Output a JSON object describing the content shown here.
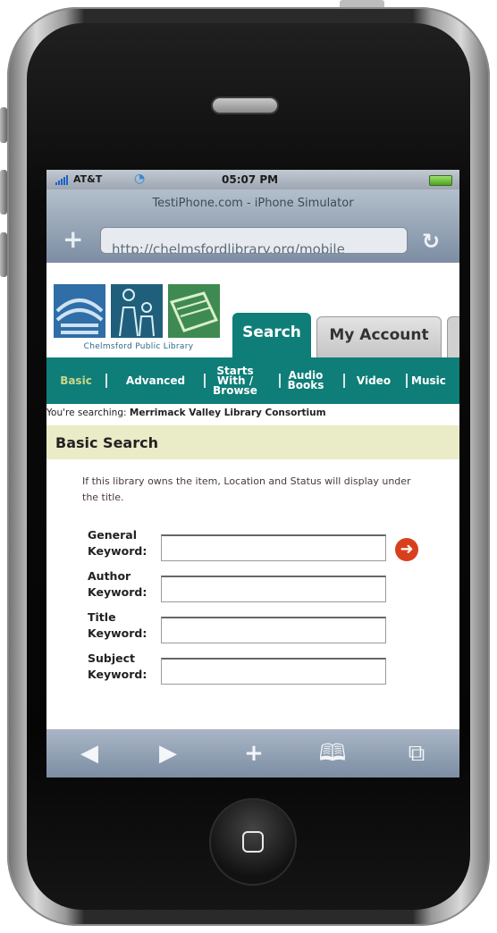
{
  "status_bar": {
    "carrier": "AT&T",
    "time": "05:07 PM"
  },
  "browser": {
    "title": "TestiPhone.com - iPhone Simulator",
    "url": "http://chelmsfordlibrary.org/mobile"
  },
  "library": {
    "logo_caption": "Chelmsford Public Library",
    "tabs": [
      {
        "label": "Search",
        "active": true
      },
      {
        "label": "My Account",
        "active": false
      }
    ],
    "subnav": [
      {
        "label": "Basic"
      },
      {
        "label": "Advanced"
      },
      {
        "label": "Starts With / Browse"
      },
      {
        "label": "Audio Books"
      },
      {
        "label": "Video"
      },
      {
        "label": "Music"
      }
    ],
    "searching_prefix": "You're searching:",
    "searching_target": "Merrimack Valley Library Consortium",
    "section_title": "Basic Search",
    "note": "If this library owns the item, Location and Status will display under the title.",
    "fields": [
      {
        "line1": "General",
        "line2": "Keyword:",
        "value": ""
      },
      {
        "line1": "Author",
        "line2": "Keyword:",
        "value": ""
      },
      {
        "line1": "Title",
        "line2": "Keyword:",
        "value": ""
      },
      {
        "line1": "Subject",
        "line2": "Keyword:",
        "value": ""
      }
    ]
  },
  "icons": {
    "go": "arrow-right-icon",
    "back": "back-icon",
    "forward": "forward-icon",
    "add": "plus-icon",
    "bookmarks": "book-icon",
    "pages": "pages-icon"
  },
  "colors": {
    "accent": "#0f7e78",
    "section_bg": "#eaebc7",
    "go_button": "#d8401c"
  }
}
